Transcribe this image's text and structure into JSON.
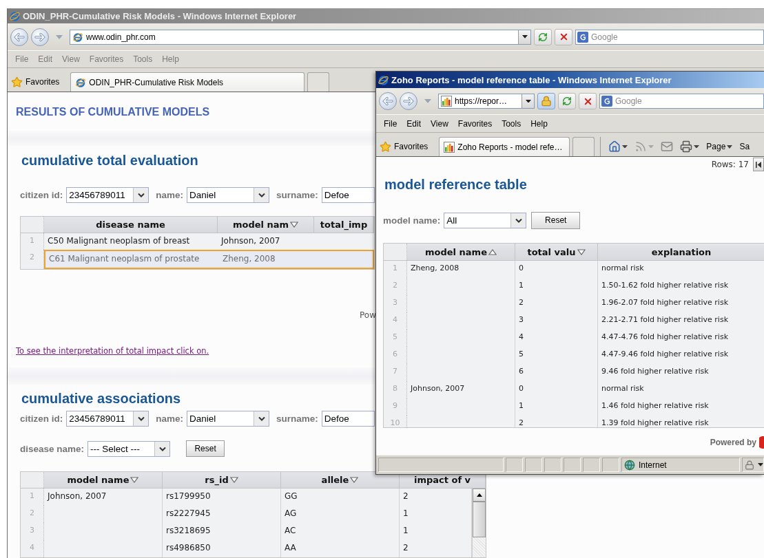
{
  "back_window": {
    "active": false,
    "title": "ODIN_PHR-Cumulative Risk Models - Windows Internet Explorer",
    "address": "www.odin_phr.com",
    "search_placeholder": "Google",
    "menu": [
      "File",
      "Edit",
      "View",
      "Favorites",
      "Tools",
      "Help"
    ],
    "favorites": "Favorites",
    "tabs": [
      {
        "label": "ODIN_PHR-Cumulative Risk Models",
        "selected": true
      }
    ],
    "page": {
      "heading": "RESULTS OF CUMULATIVE MODELS",
      "evaluation": {
        "title": "cumulative total evaluation",
        "filters": [
          {
            "kind": "select",
            "label": "citizen id:",
            "value": "23456789011"
          },
          {
            "kind": "select",
            "label": "name:",
            "value": "Daniel"
          },
          {
            "kind": "text",
            "label": "surname:",
            "value": "Defoe"
          }
        ],
        "table": {
          "columns": [
            {
              "label": "disease name",
              "kind": "plain"
            },
            {
              "label": "model nam",
              "kind": "sort_down"
            },
            {
              "label": "total_imp",
              "kind": "plain"
            }
          ],
          "rows": [
            {
              "number": "1",
              "selected": false,
              "cells": [
                "C50 Malignant neoplasm of breast",
                "Johnson, 2007"
              ]
            },
            {
              "number": "2",
              "selected": true,
              "cells": [
                "C61 Malignant neoplasm of prostate",
                "Zheng, 2008"
              ]
            }
          ]
        },
        "powered_by": "Pow"
      },
      "link": "To see the interpretation of total impact click on.",
      "associations": {
        "title": "cumulative associations",
        "filters": [
          {
            "kind": "select",
            "label": "citizen id:",
            "value": "23456789011"
          },
          {
            "kind": "select",
            "label": "name:",
            "value": "Daniel"
          },
          {
            "kind": "text",
            "label": "surname:",
            "value": "Defoe"
          }
        ],
        "disease_filter": {
          "label": "disease name:",
          "value": "--- Select ---"
        },
        "reset": "Reset",
        "table": {
          "columns": [
            {
              "label": "model name",
              "kind": "sort_down"
            },
            {
              "label": "rs_id",
              "kind": "sort_down"
            },
            {
              "label": "allele",
              "kind": "sort_down"
            },
            {
              "label": "impact of v",
              "kind": "plain"
            }
          ],
          "groups": [
            {
              "model": "Johnson, 2007",
              "entries": [
                {
                  "number": "1",
                  "cells": [
                    "rs1799950",
                    "GG",
                    "2"
                  ]
                },
                {
                  "number": "2",
                  "cells": [
                    "rs2227945",
                    "AG",
                    "1"
                  ]
                },
                {
                  "number": "3",
                  "cells": [
                    "rs3218695",
                    "AC",
                    "1"
                  ]
                },
                {
                  "number": "4",
                  "cells": [
                    "rs4986850",
                    "AA",
                    "2"
                  ]
                }
              ]
            }
          ]
        }
      }
    }
  },
  "front_window": {
    "active": true,
    "title": "Zoho Reports - model reference table - Windows Internet Explorer",
    "address": "https://repor…",
    "search_placeholder": "Google",
    "menu": [
      "File",
      "Edit",
      "View",
      "Favorites",
      "Tools",
      "Help"
    ],
    "favorites": "Favorites",
    "tabs": [
      {
        "label": "Zoho Reports - model refe…",
        "selected": true
      }
    ],
    "commands": [
      {
        "label": "Page",
        "menu": true
      },
      {
        "label": "Sa",
        "menu": false
      }
    ],
    "page": {
      "rows_count": "Rows: 17",
      "title": "model reference table",
      "filter": {
        "label": "model name:",
        "value": "All"
      },
      "reset": "Reset",
      "table": {
        "columns": [
          {
            "label": "model name",
            "kind": "sort_up"
          },
          {
            "label": "total valu",
            "kind": "sort_down"
          },
          {
            "label": "explanation",
            "kind": "plain"
          }
        ],
        "groups": [
          {
            "model": "Zheng, 2008",
            "entries": [
              {
                "number": "1",
                "cells": [
                  "0",
                  "normal risk"
                ]
              },
              {
                "number": "2",
                "cells": [
                  "1",
                  "1.50-1.62 fold higher relative risk"
                ]
              },
              {
                "number": "3",
                "cells": [
                  "2",
                  "1.96-2.07 fold higher relative risk"
                ]
              },
              {
                "number": "4",
                "cells": [
                  "3",
                  "2.21-2.71 fold higher relative risk"
                ]
              },
              {
                "number": "5",
                "cells": [
                  "4",
                  "4.47-4.76 fold higher relative risk"
                ]
              },
              {
                "number": "6",
                "cells": [
                  "5",
                  "4.47-9.46 fold higher relative risk"
                ]
              },
              {
                "number": "7",
                "cells": [
                  "6",
                  "9.46 fold higher relative risk"
                ]
              }
            ]
          },
          {
            "model": "Johnson, 2007",
            "entries": [
              {
                "number": "8",
                "cells": [
                  "0",
                  "normal risk"
                ]
              },
              {
                "number": "9",
                "cells": [
                  "1",
                  "1.46 fold higher relative risk"
                ]
              },
              {
                "number": "10",
                "cells": [
                  "2",
                  "1.39 fold higher relative risk"
                ]
              }
            ]
          }
        ]
      },
      "powered_by": "Powered by"
    },
    "status": {
      "zone": "Internet"
    }
  }
}
